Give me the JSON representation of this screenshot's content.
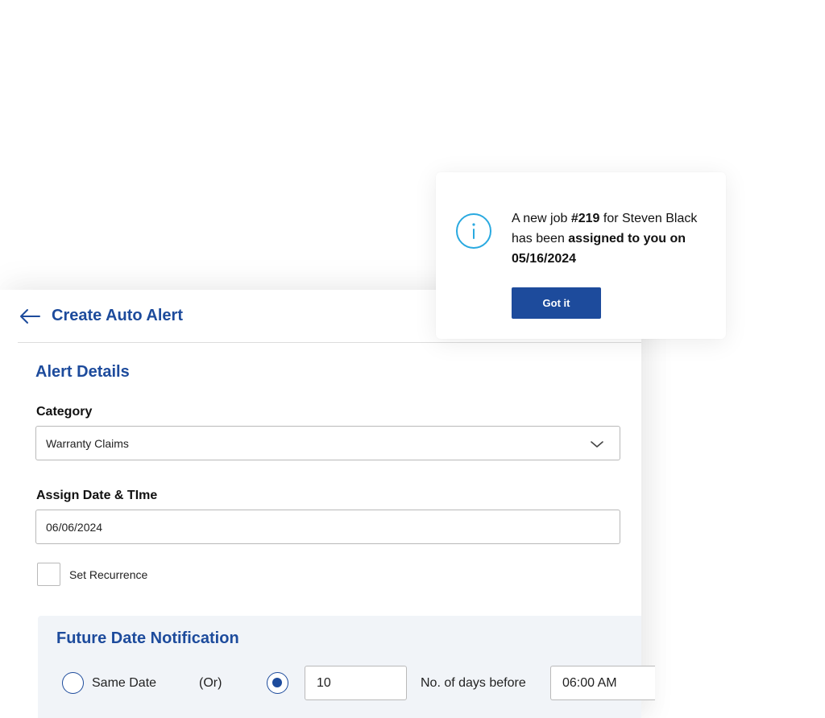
{
  "form": {
    "title": "Create Auto Alert",
    "section_title": "Alert Details",
    "category": {
      "label": "Category",
      "value": "Warranty Claims"
    },
    "assign": {
      "label": "Assign Date & TIme",
      "value": "06/06/2024"
    },
    "recurrence_label": "Set Recurrence",
    "future": {
      "title": "Future Date Notification",
      "same_date_label": "Same Date",
      "or_label": "(Or)",
      "days_value": "10",
      "days_label": "No. of days before",
      "time_value": "06:00 AM"
    }
  },
  "toast": {
    "msg_part1": "A new job ",
    "job_number": "#219",
    "msg_part2": " for Steven Black has been ",
    "msg_bold": "assigned to you on 05/16/2024",
    "button_label": "Got it"
  },
  "colors": {
    "accent": "#1d4b9c",
    "info_icon": "#29a9e0",
    "panel_bg": "#f1f4f8"
  },
  "icons": {
    "back": "arrow-left-icon",
    "dropdown": "chevron-down-icon",
    "info": "info-circle-icon"
  }
}
